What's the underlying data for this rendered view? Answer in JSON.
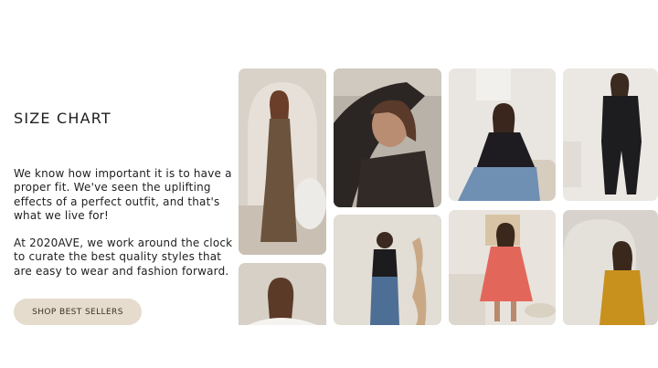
{
  "section": {
    "title": "SIZE CHART",
    "paragraph_1": "We know how important it is to have a proper fit.  We've seen the uplifting effects of a perfect outfit, and that's what we live for!",
    "paragraph_2": "At 2020AVE, we work around the clock to curate the best quality styles that are easy to wear and fashion forward.",
    "cta_label": "SHOP BEST SELLERS"
  },
  "colors": {
    "button_bg": "#e5dccd",
    "text": "#1e1e1e"
  },
  "gallery": [
    {
      "name": "photo-brown-maxi-dress"
    },
    {
      "name": "photo-sheer-black-top-closeup"
    },
    {
      "name": "photo-black-top-jeans-sitting"
    },
    {
      "name": "photo-black-jumpsuit"
    },
    {
      "name": "photo-white-offshoulder-top"
    },
    {
      "name": "photo-black-tank-jeans-back"
    },
    {
      "name": "photo-coral-tiered-dress"
    },
    {
      "name": "photo-mustard-top"
    }
  ]
}
